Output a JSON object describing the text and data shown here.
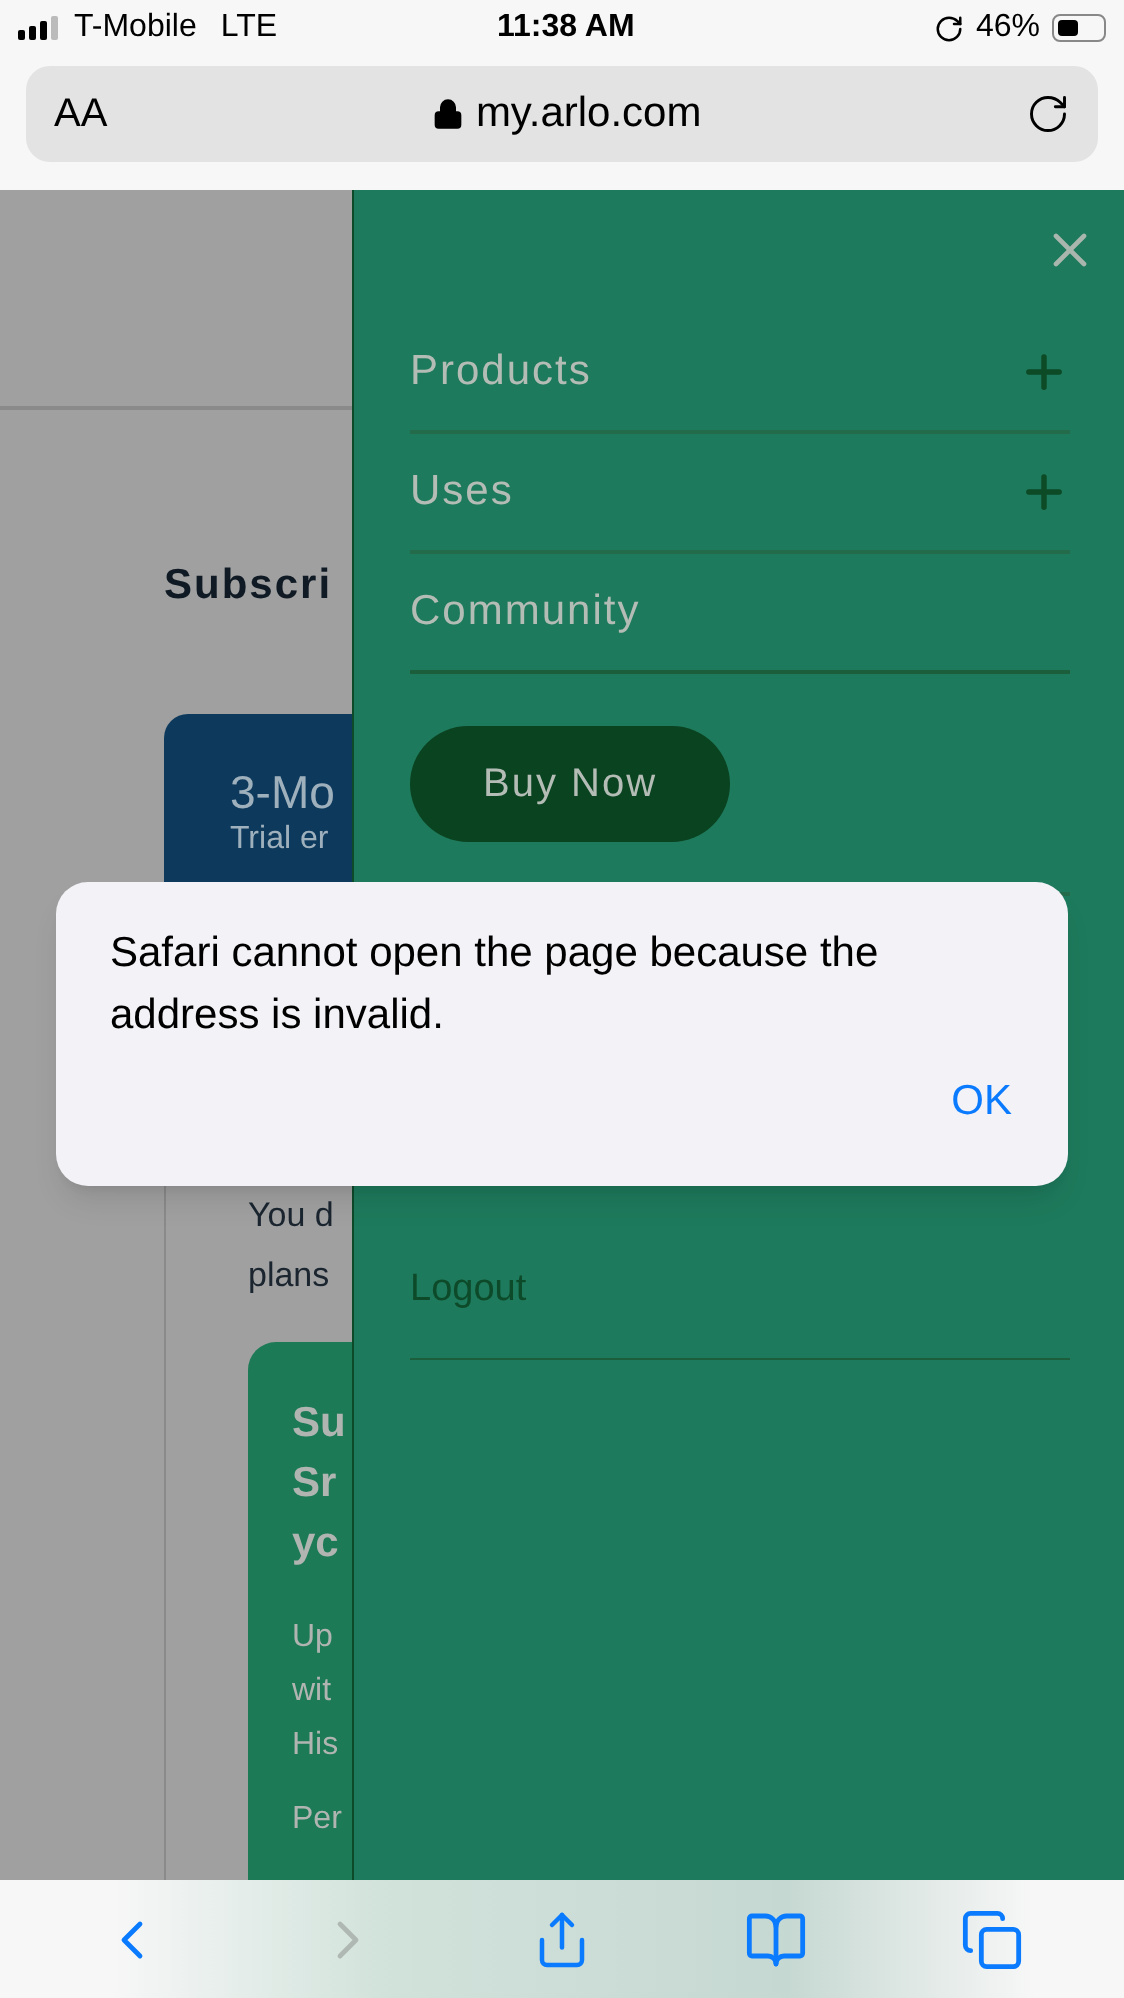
{
  "status_bar": {
    "carrier": "T-Mobile",
    "network": "LTE",
    "time": "11:38 AM",
    "battery_percent": "46%"
  },
  "address_bar": {
    "text_size_label": "AA",
    "url": "my.arlo.com"
  },
  "page": {
    "heading": "Subscri",
    "plan_card": {
      "title": "3-Mo",
      "subtitle": "Trial er"
    },
    "note_lines": [
      "You d",
      "plans"
    ],
    "promo_card": {
      "title_lines": [
        "Su",
        "Sr",
        "yc"
      ],
      "body_lines": [
        "Up",
        "wit",
        "His"
      ],
      "footer": "Per"
    }
  },
  "menu": {
    "items": [
      {
        "label": "Products",
        "expandable": true
      },
      {
        "label": "Uses",
        "expandable": true
      },
      {
        "label": "Community",
        "expandable": false
      }
    ],
    "buy_button": "Buy Now",
    "account_items": [
      "Logout"
    ]
  },
  "alert": {
    "message": "Safari cannot open the page because the address is invalid.",
    "button": "OK"
  },
  "toolbar": {
    "back_enabled": true,
    "forward_enabled": false
  }
}
